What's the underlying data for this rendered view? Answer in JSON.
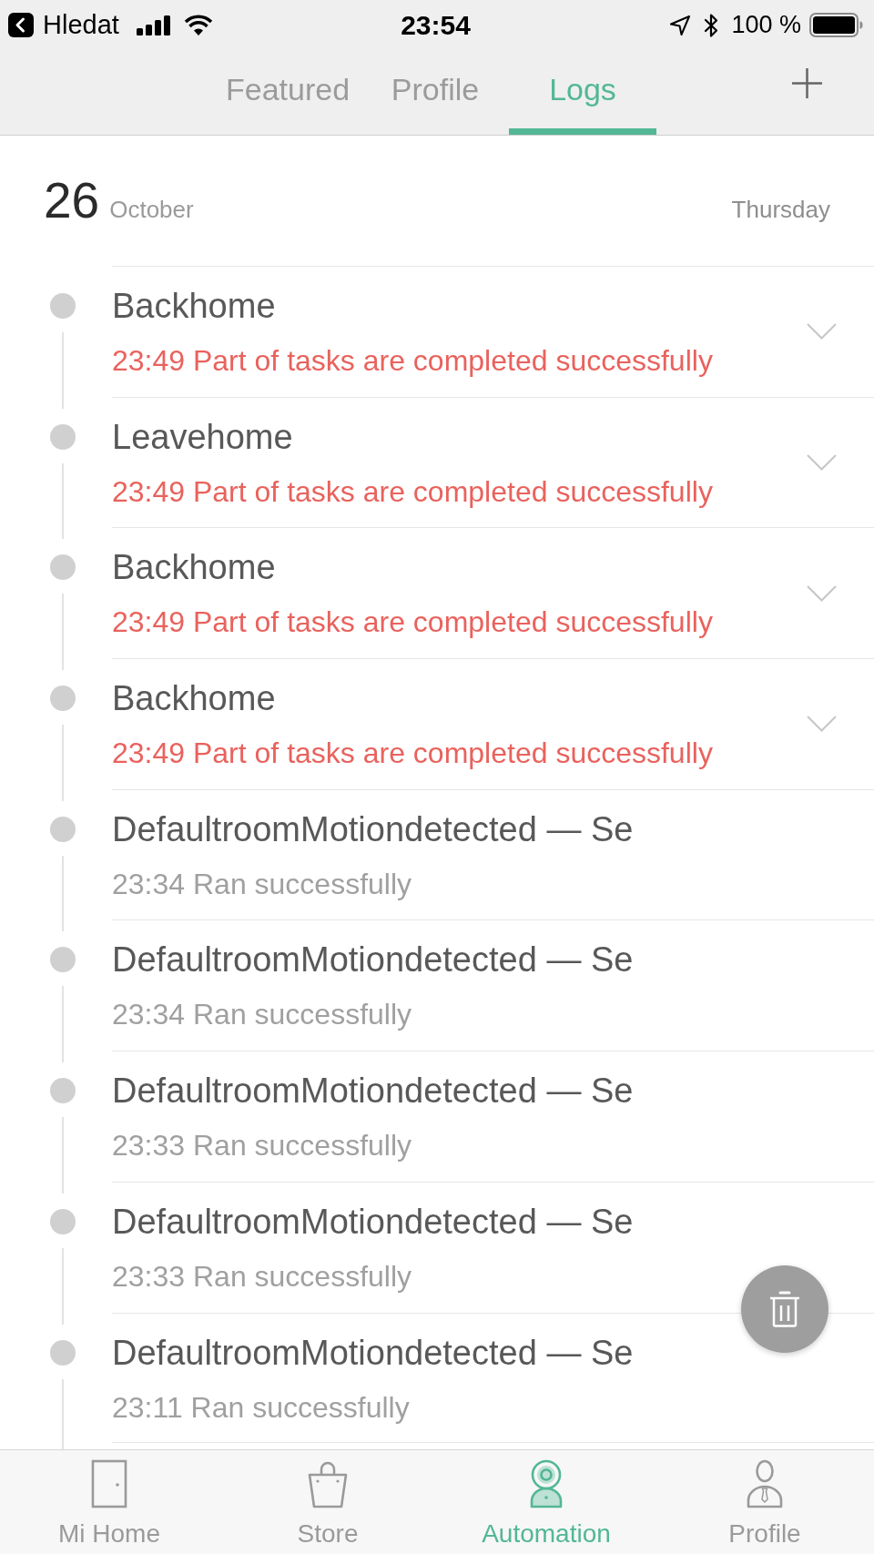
{
  "status_bar": {
    "back_label": "Hledat",
    "time": "23:54",
    "battery": "100 %"
  },
  "tabs": [
    {
      "label": "Featured",
      "selected": false
    },
    {
      "label": "Profile",
      "selected": false
    },
    {
      "label": "Logs",
      "selected": true
    }
  ],
  "date_header": {
    "day": "26",
    "month": "October",
    "weekday": "Thursday"
  },
  "logs": [
    {
      "title": "Backhome",
      "result": "23:49 Part of tasks are completed successfully",
      "warning": true,
      "expandable": true
    },
    {
      "title": "Leavehome",
      "result": "23:49 Part of tasks are completed successfully",
      "warning": true,
      "expandable": true
    },
    {
      "title": "Backhome",
      "result": "23:49 Part of tasks are completed successfully",
      "warning": true,
      "expandable": true
    },
    {
      "title": "Backhome",
      "result": "23:49 Part of tasks are completed successfully",
      "warning": true,
      "expandable": true
    },
    {
      "title": "DefaultroomMotiondetected — Se",
      "result": "23:34 Ran successfully",
      "warning": false,
      "expandable": false
    },
    {
      "title": "DefaultroomMotiondetected — Se",
      "result": "23:34 Ran successfully",
      "warning": false,
      "expandable": false
    },
    {
      "title": "DefaultroomMotiondetected — Se",
      "result": "23:33 Ran successfully",
      "warning": false,
      "expandable": false
    },
    {
      "title": "DefaultroomMotiondetected — Se",
      "result": "23:33 Ran successfully",
      "warning": false,
      "expandable": false
    },
    {
      "title": "DefaultroomMotiondetected — Se",
      "result": "23:11 Ran successfully",
      "warning": false,
      "expandable": false
    }
  ],
  "bottom_nav": [
    {
      "label": "Mi Home",
      "selected": false
    },
    {
      "label": "Store",
      "selected": false
    },
    {
      "label": "Automation",
      "selected": true
    },
    {
      "label": "Profile",
      "selected": false
    }
  ]
}
